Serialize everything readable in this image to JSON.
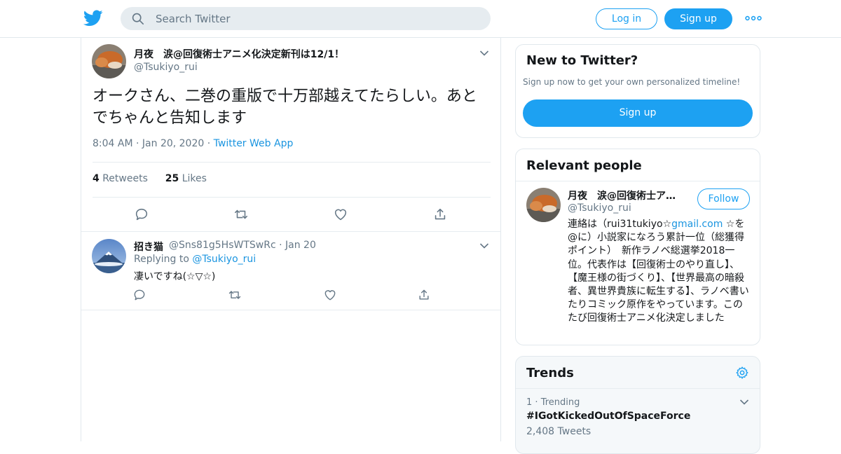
{
  "header": {
    "search_placeholder": "Search Twitter",
    "login_label": "Log in",
    "signup_label": "Sign up",
    "brand_color": "#1da1f2"
  },
  "tweet": {
    "display_name": "月夜　涙@回復術士アニメ化決定新刊は12/1！",
    "handle": "@Tsukiyo_rui",
    "text": "オークさん、二巻の重版で十万部越えてたらしい。あとでちゃんと告知します",
    "time": "8:04 AM",
    "date": "Jan 20, 2020",
    "source": "Twitter Web App",
    "retweets_count": "4",
    "retweets_label": "Retweets",
    "likes_count": "25",
    "likes_label": "Likes",
    "icons": [
      "reply-icon",
      "retweet-icon",
      "like-icon",
      "share-icon"
    ]
  },
  "reply": {
    "display_name": "招き猫",
    "handle": "@Sns81g5HsWTSwRc",
    "date": "Jan 20",
    "replying_prefix": "Replying to",
    "replying_to": "@Tsukiyo_rui",
    "text": "凄いですね(☆▽☆)"
  },
  "sidebar": {
    "new_to_twitter": {
      "title": "New to Twitter?",
      "subtitle": "Sign up now to get your own personalized timeline!",
      "button": "Sign up"
    },
    "relevant_people": {
      "title": "Relevant people",
      "name": "月夜　涙@回復術士ア…",
      "handle": "@Tsukiyo_rui",
      "follow_label": "Follow",
      "bio_prefix": "連絡は（rui31tukiyo☆",
      "bio_link": "gmail.com",
      "bio_rest": " ☆を@に）小説家になろう累計一位（総獲得ポイント）　新作ラノベ総選挙2018一位。代表作は【回復術士のやり直し】、【魔王様の街づくり】、【世界最高の暗殺者、異世界貴族に転生する】、ラノベ書いたりコミック原作をやっています。このたび回復術士アニメ化決定しました"
    },
    "trends": {
      "title": "Trends",
      "items": [
        {
          "rank": "1",
          "context": "Trending",
          "name": "#IGotKickedOutOfSpaceForce",
          "count": "2,408 Tweets"
        }
      ]
    }
  }
}
